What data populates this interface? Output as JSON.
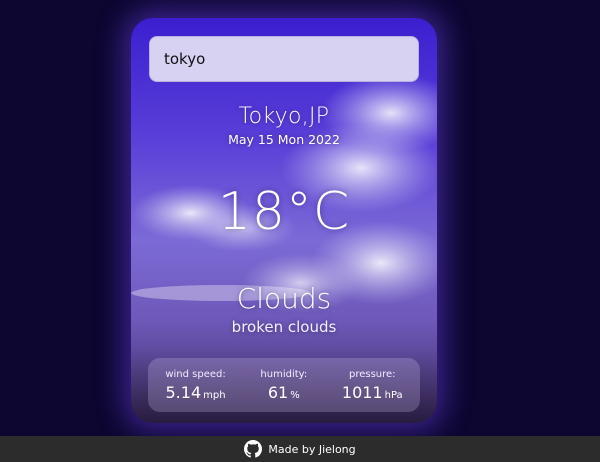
{
  "search": {
    "value": "tokyo"
  },
  "weather": {
    "location": "Tokyo,JP",
    "date": "May 15 Mon 2022",
    "temperature": "18°C",
    "condition": "Clouds",
    "description": "broken clouds"
  },
  "stats": {
    "wind": {
      "label": "wind speed:",
      "value": "5.14",
      "unit": "mph"
    },
    "humidity": {
      "label": "humidity:",
      "value": "61",
      "unit": "%"
    },
    "pressure": {
      "label": "pressure:",
      "value": "1011",
      "unit": "hPa"
    }
  },
  "footer": {
    "text": "Made by Jielong",
    "icon": "github-icon"
  },
  "colors": {
    "page_bg": "#0c0630",
    "card_glow": "#7846ff",
    "footer_bg": "#2c2c2c"
  }
}
